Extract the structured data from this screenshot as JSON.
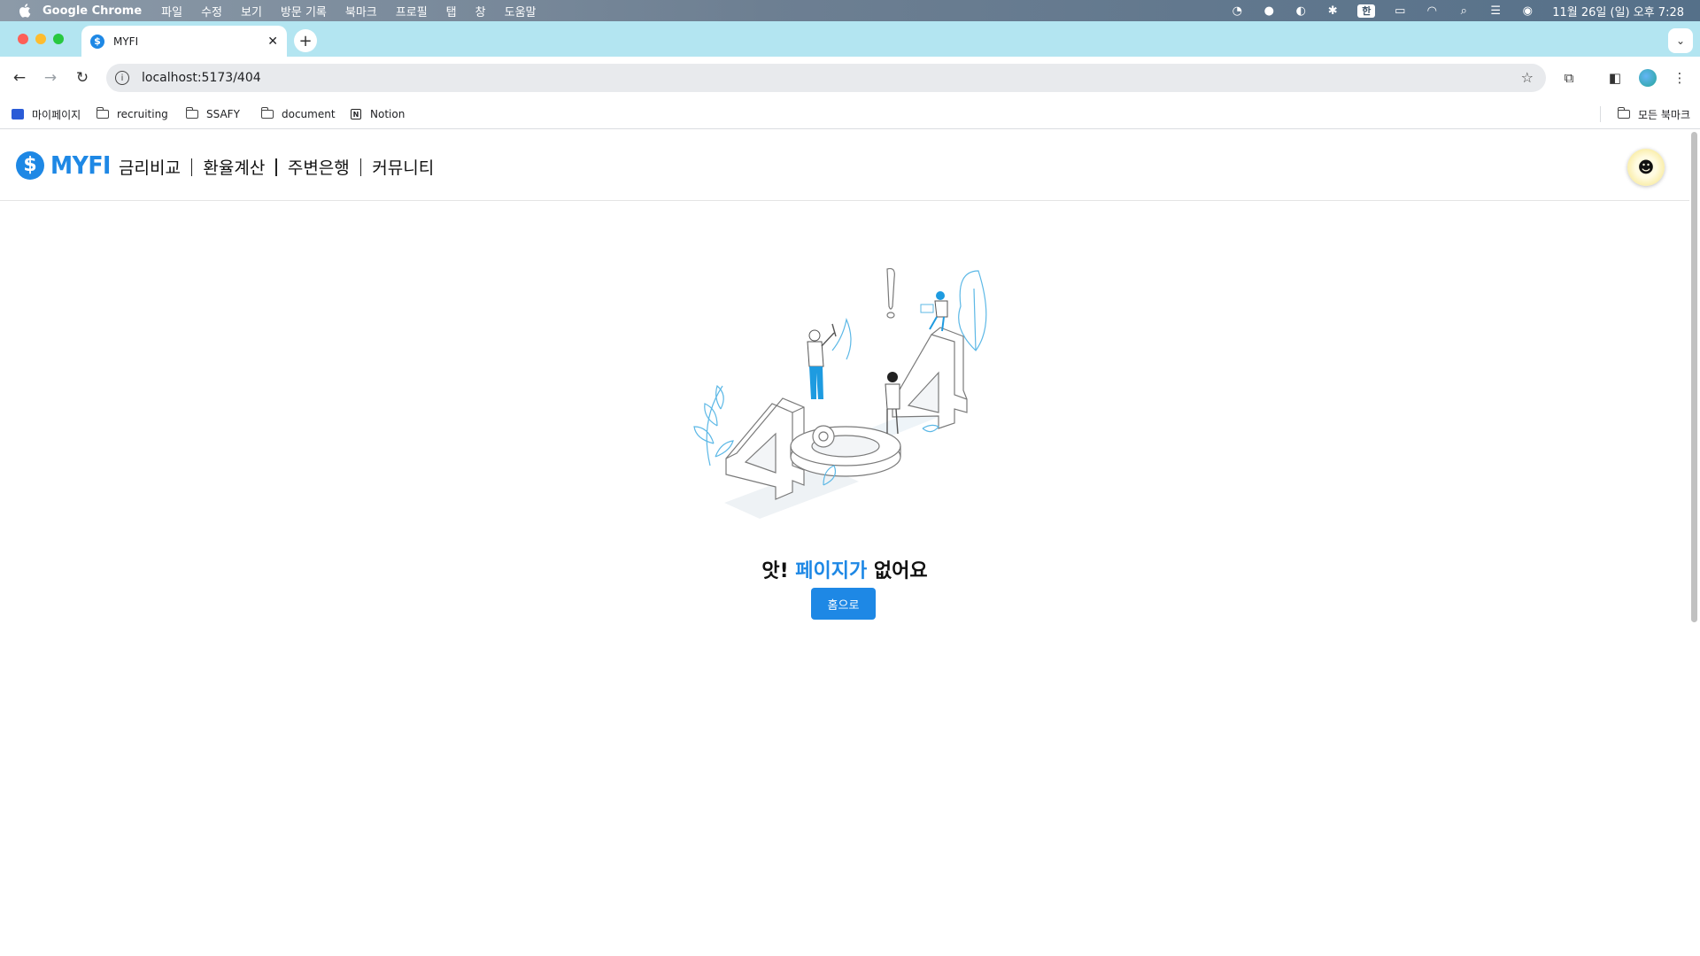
{
  "os_menubar": {
    "app_name": "Google Chrome",
    "menus": [
      "파일",
      "수정",
      "보기",
      "방문 기록",
      "북마크",
      "프로필",
      "탭",
      "창",
      "도움말"
    ],
    "input_method": "한",
    "clock": "11월 26일 (일) 오후 7:28"
  },
  "browser": {
    "tab": {
      "title": "MYFI",
      "favicon": "$"
    },
    "address": "localhost:5173/404",
    "bookmarks": [
      {
        "label": "마이페이지",
        "icon": "site-icon"
      },
      {
        "label": "recruiting",
        "icon": "folder-icon"
      },
      {
        "label": "SSAFY",
        "icon": "folder-icon"
      },
      {
        "label": "document",
        "icon": "folder-icon"
      },
      {
        "label": "Notion",
        "icon": "notion-icon"
      }
    ],
    "all_bookmarks": "모든 북마크"
  },
  "site": {
    "logo_symbol": "$",
    "brand": "MYFI",
    "nav": [
      "금리비교",
      "환율계산",
      "주변은행",
      "커뮤니티"
    ]
  },
  "error": {
    "title_before": "앗! ",
    "title_highlight": "페이지가",
    "title_after": " 없어요",
    "button": "홈으로",
    "accent_color": "#1e88e5"
  }
}
